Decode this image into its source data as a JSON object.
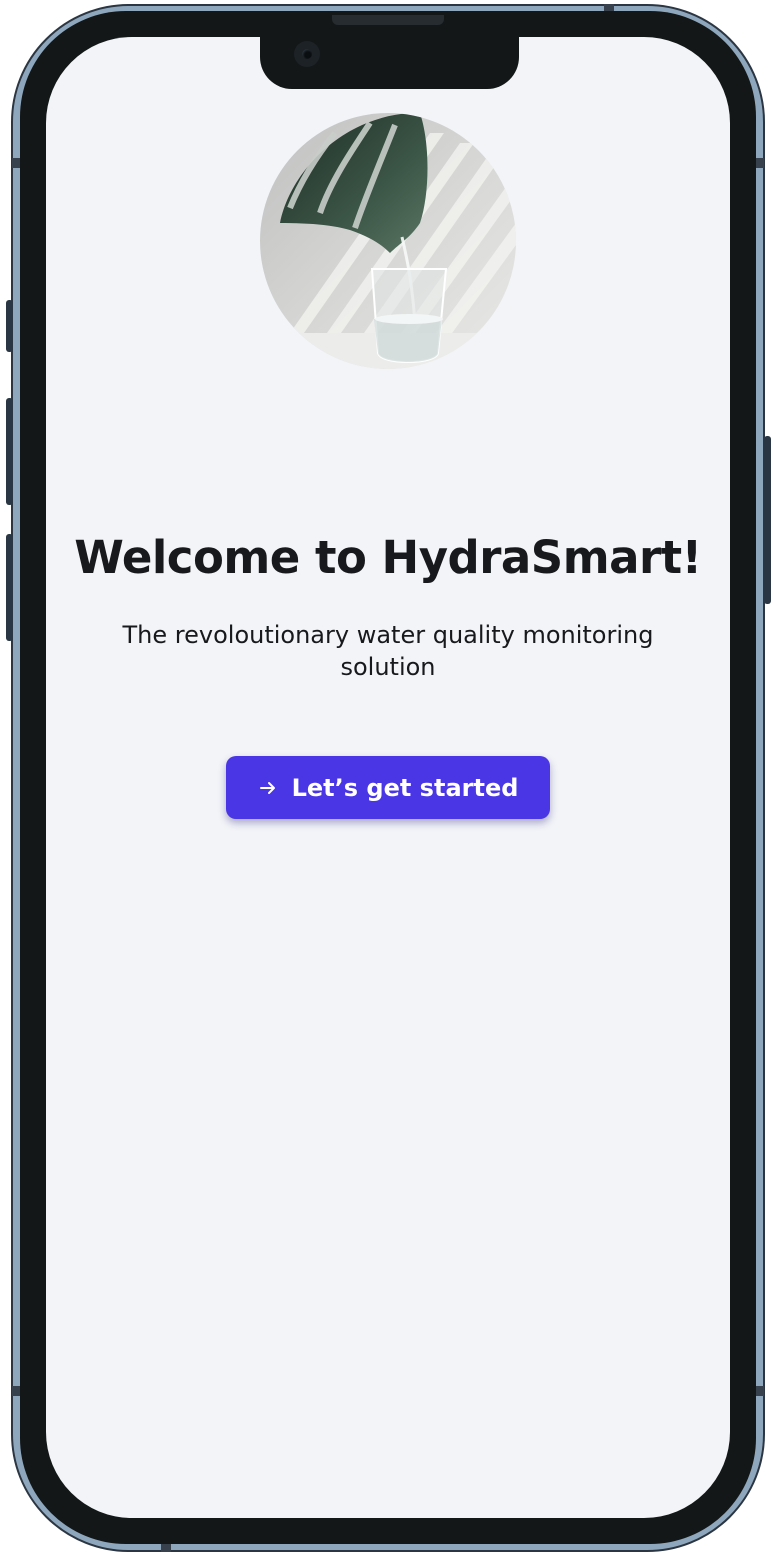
{
  "welcome": {
    "title": "Welcome to HydraSmart!",
    "subtitle": "The revoloutionary water quality monitoring solution",
    "cta_label": "Let’s get started",
    "cta_icon": "arrow-right-icon",
    "hero_image": "monstera-leaf-pouring-water-into-glass"
  },
  "colors": {
    "screen_background": "#f2f4f8",
    "primary_button": "#4a36e4",
    "text": "#17191c",
    "device_frame": "#8ea7bd",
    "bezel": "#141717"
  }
}
